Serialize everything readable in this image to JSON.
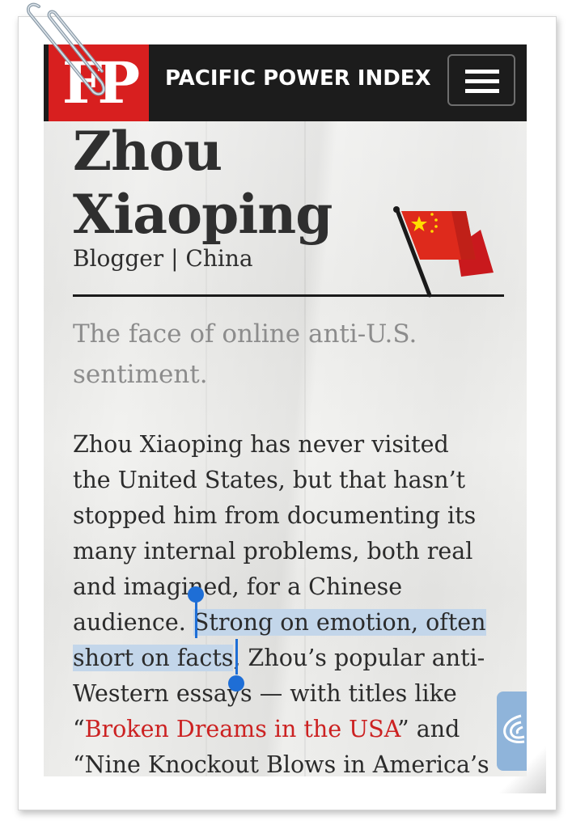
{
  "header": {
    "logo_text": "FP",
    "title": "PACIFIC POWER INDEX",
    "menu_icon": "hamburger-menu-icon",
    "colors": {
      "bar": "#1c1c1c",
      "logo": "#d81f1f"
    }
  },
  "profile": {
    "name_line1": "Zhou",
    "name_line2": "Xiaoping",
    "role": "Blogger | China",
    "flag_icon": "china-flag-icon"
  },
  "article": {
    "dek_line1": "The face of online anti-U.S.",
    "dek_line2": "sentiment.",
    "body": {
      "l1": "Zhou Xiaoping has never visited",
      "l2": "the United States, but that hasn’t",
      "l3": "stopped him from documenting its",
      "l4": "many internal problems, both real",
      "l5": "and imagined, for a Chinese",
      "l6_plain": "audience. ",
      "l6_selected": "Strong on emotion, often",
      "l7_selected": "short on facts",
      "l7_plain": ", Zhou’s popular anti-",
      "l8": "Western essays — with titles like",
      "l9_open": "“",
      "l9_link": "Broken Dreams in the USA",
      "l9_close": "” and",
      "l10": "“Nine Knockout Blows in America’s"
    },
    "link_color": "#cc2222",
    "selection_color": "#c3d6ea"
  },
  "overlay": {
    "side_tab_icon": "network-logo-icon",
    "clip_icon": "paperclip-icon"
  }
}
